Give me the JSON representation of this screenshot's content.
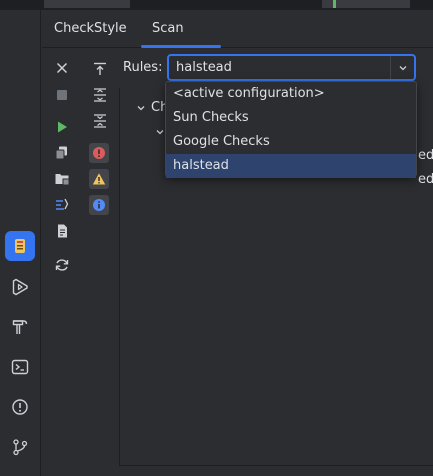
{
  "tool_window": {
    "tabs": [
      {
        "label": "CheckStyle"
      },
      {
        "label": "Scan"
      }
    ]
  },
  "rules": {
    "label": "Rules:",
    "selected": "halstead",
    "options": [
      "<active configuration>",
      "Sun Checks",
      "Google Checks",
      "halstead"
    ]
  },
  "tree": {
    "root_fragment": "Ch",
    "row_fragment_1": "ed",
    "row_fragment_2": "ed"
  },
  "colors": {
    "accent": "#3574f0",
    "run_green": "#5fb865",
    "error_red": "#db5c5c",
    "warning_yellow": "#f2c55c",
    "info_blue": "#548af7",
    "selection": "#2e436e"
  }
}
